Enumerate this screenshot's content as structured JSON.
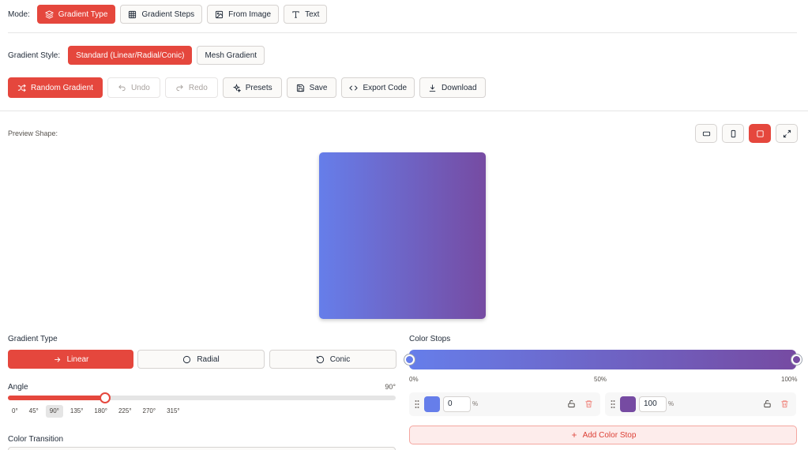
{
  "mode": {
    "label": "Mode:",
    "options": [
      {
        "label": "Gradient Type",
        "icon": "layers-icon",
        "active": true
      },
      {
        "label": "Gradient Steps",
        "icon": "grid-icon",
        "active": false
      },
      {
        "label": "From Image",
        "icon": "image-icon",
        "active": false
      },
      {
        "label": "Text",
        "icon": "text-icon",
        "active": false
      }
    ]
  },
  "style": {
    "label": "Gradient Style:",
    "options": [
      {
        "label": "Standard (Linear/Radial/Conic)",
        "active": true
      },
      {
        "label": "Mesh Gradient",
        "active": false
      }
    ]
  },
  "toolbar": {
    "random": "Random Gradient",
    "undo": "Undo",
    "redo": "Redo",
    "presets": "Presets",
    "save": "Save",
    "export": "Export Code",
    "download": "Download"
  },
  "preview": {
    "label": "Preview Shape:",
    "shapes": [
      "landscape-icon",
      "portrait-icon",
      "square-icon",
      "fullscreen-icon"
    ],
    "active_shape": "square-icon"
  },
  "colors": {
    "accent": "#e5473d",
    "stop1": "#667eea",
    "stop2": "#764ba2"
  },
  "gradient_type": {
    "label": "Gradient Type",
    "options": [
      {
        "label": "Linear",
        "icon": "arrow-right-icon",
        "active": true
      },
      {
        "label": "Radial",
        "icon": "circle-icon",
        "active": false
      },
      {
        "label": "Conic",
        "icon": "rotate-icon",
        "active": false
      }
    ]
  },
  "angle": {
    "label": "Angle",
    "value_text": "90°",
    "value": 90,
    "max": 360,
    "presets": [
      "0°",
      "45°",
      "90°",
      "135°",
      "180°",
      "225°",
      "270°",
      "315°"
    ],
    "active_preset": "90°"
  },
  "transition": {
    "label": "Color Transition"
  },
  "color_stops": {
    "label": "Color Stops",
    "scale": [
      "0%",
      "50%",
      "100%"
    ],
    "stops": [
      {
        "position": "0",
        "unit": "%",
        "color": "#667eea",
        "pos_value": 0
      },
      {
        "position": "100",
        "unit": "%",
        "color": "#764ba2",
        "pos_value": 100
      }
    ],
    "add_label": "Add Color Stop"
  }
}
